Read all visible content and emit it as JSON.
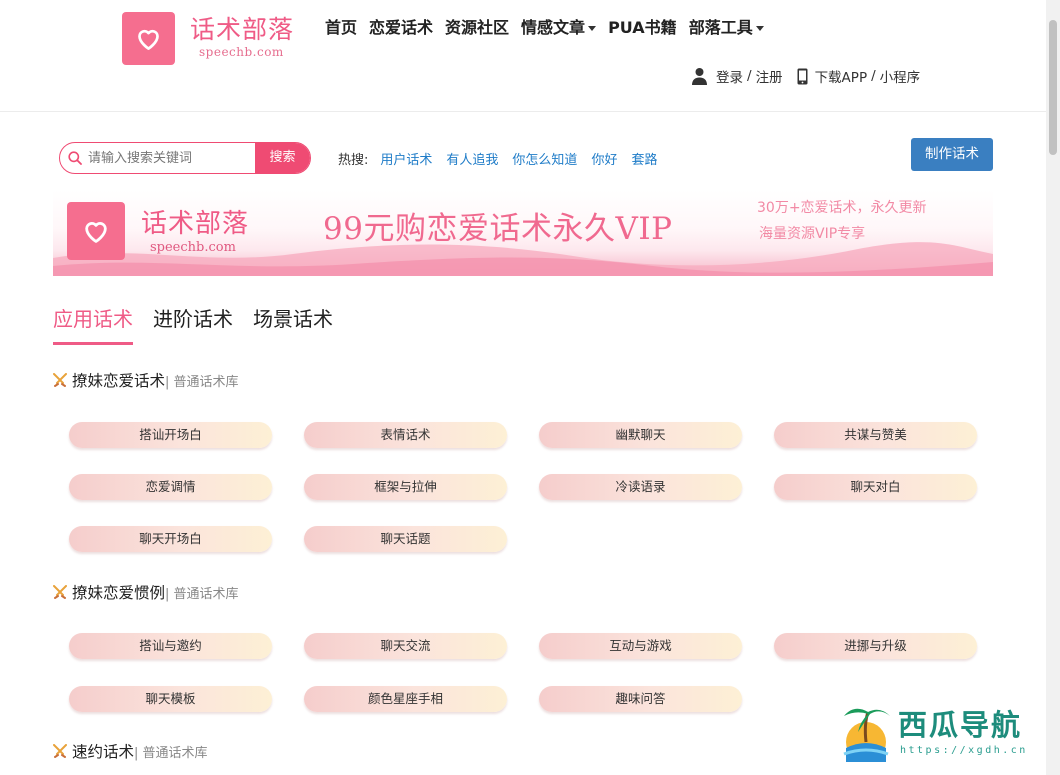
{
  "header": {
    "logo_text": "话术部落",
    "logo_sub": "speechb.com",
    "nav": [
      {
        "label": "首页",
        "dropdown": false
      },
      {
        "label": "恋爱话术",
        "dropdown": false
      },
      {
        "label": "资源社区",
        "dropdown": false
      },
      {
        "label": "情感文章",
        "dropdown": true
      },
      {
        "label": "PUA书籍",
        "dropdown": false
      },
      {
        "label": "部落工具",
        "dropdown": true
      }
    ],
    "login": "登录",
    "register": "注册",
    "download_app": "下载APP",
    "mini_program": "小程序",
    "separator": "/"
  },
  "search": {
    "placeholder": "请输入搜索关键词",
    "button": "搜索",
    "hot_label": "热搜:",
    "hot_links": [
      "用户话术",
      "有人追我",
      "你怎么知道",
      "你好",
      "套路"
    ]
  },
  "make_button": "制作话术",
  "banner": {
    "logo_text": "话术部落",
    "logo_sub": "speechb.com",
    "main_text": "99元购恋爱话术永久VIP",
    "right_line1": "30万+恋爱话术，永久更新",
    "right_line2": "海量资源VIP专享"
  },
  "tabs": [
    "应用话术",
    "进阶话术",
    "场景话术"
  ],
  "active_tab": 0,
  "sections": [
    {
      "title": "撩妹恋爱话术",
      "subtitle": "| 普通话术库",
      "items": [
        "搭讪开场白",
        "表情话术",
        "幽默聊天",
        "共谋与赞美",
        "恋爱调情",
        "框架与拉伸",
        "冷读语录",
        "聊天对白",
        "聊天开场白",
        "聊天话题"
      ]
    },
    {
      "title": "撩妹恋爱惯例",
      "subtitle": "| 普通话术库",
      "items": [
        "搭讪与邀约",
        "聊天交流",
        "互动与游戏",
        "进挪与升级",
        "聊天模板",
        "颜色星座手相",
        "趣味问答"
      ]
    },
    {
      "title": "速约话术",
      "subtitle": "| 普通话术库",
      "items": []
    }
  ],
  "watermark": {
    "title": "西瓜导航",
    "url": "https://xgdh.cn"
  },
  "colors": {
    "brand_pink": "#ef5b86",
    "search_red": "#ef4b73",
    "link_blue": "#1f7cc8",
    "button_blue": "#3a7fc1"
  }
}
